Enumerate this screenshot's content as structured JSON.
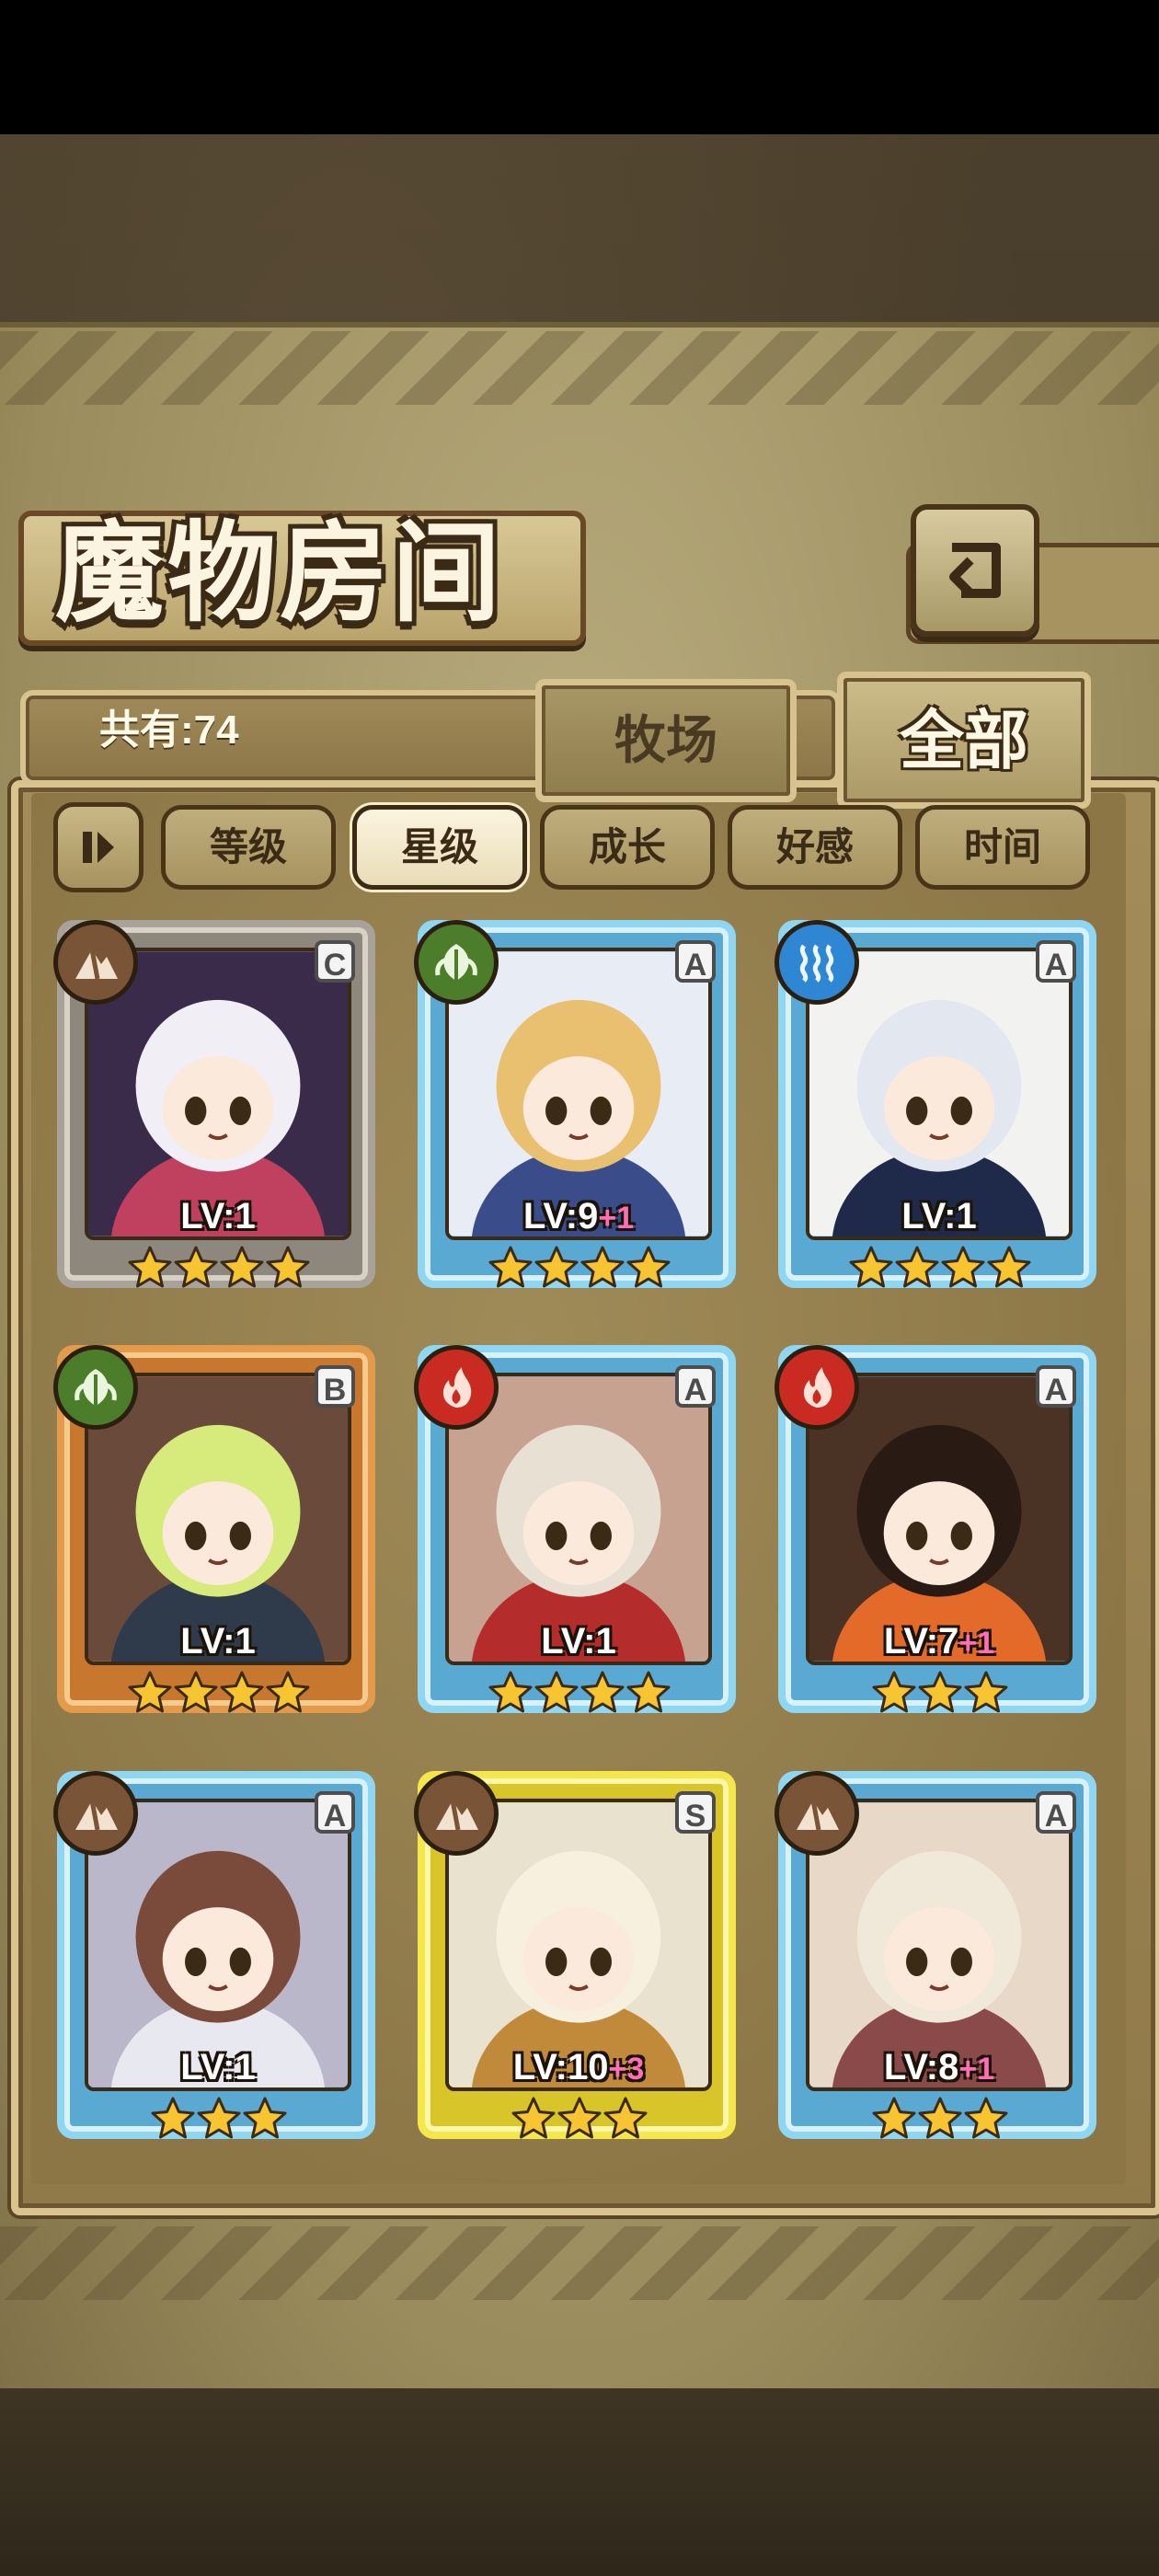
{
  "title": "魔物房间",
  "count_label": "共有:74",
  "tabs": [
    {
      "label": "牧场",
      "active": false
    },
    {
      "label": "全部",
      "active": true
    }
  ],
  "sort_buttons": [
    {
      "label": "等级",
      "active": false
    },
    {
      "label": "星级",
      "active": true
    },
    {
      "label": "成长",
      "active": false
    },
    {
      "label": "好感",
      "active": false
    },
    {
      "label": "时间",
      "active": false
    }
  ],
  "monsters": [
    {
      "rank": "C",
      "element": "earth-icon",
      "level": "LV:1",
      "bonus": "",
      "stars": 4,
      "frame": "c",
      "palette": [
        "#3a2b4a",
        "#f1eef5",
        "#c04060"
      ]
    },
    {
      "rank": "A",
      "element": "leaf-icon",
      "level": "LV:9",
      "bonus": "+1",
      "stars": 4,
      "frame": "a",
      "palette": [
        "#e8ecf4",
        "#e8c070",
        "#3a4d8a"
      ]
    },
    {
      "rank": "A",
      "element": "water-icon",
      "level": "LV:1",
      "bonus": "",
      "stars": 4,
      "frame": "a",
      "palette": [
        "#f2f2f0",
        "#e3e7f0",
        "#1f2a4a"
      ]
    },
    {
      "rank": "B",
      "element": "leaf-icon",
      "level": "LV:1",
      "bonus": "",
      "stars": 4,
      "frame": "b",
      "palette": [
        "#6a4a3a",
        "#d7ea7c",
        "#2f3a4a"
      ]
    },
    {
      "rank": "A",
      "element": "fire-icon",
      "level": "LV:1",
      "bonus": "",
      "stars": 4,
      "frame": "a",
      "palette": [
        "#c7a290",
        "#e8e0d2",
        "#b52c2c"
      ]
    },
    {
      "rank": "A",
      "element": "fire-icon",
      "level": "LV:7",
      "bonus": "+1",
      "stars": 3,
      "frame": "a",
      "palette": [
        "#4a3224",
        "#2a1a14",
        "#e46a2a"
      ]
    },
    {
      "rank": "A",
      "element": "earth-icon",
      "level": "LV:1",
      "bonus": "",
      "stars": 3,
      "frame": "a",
      "palette": [
        "#b9b7c9",
        "#7a4a3a",
        "#e8e8f0"
      ]
    },
    {
      "rank": "S",
      "element": "earth-icon",
      "level": "LV:10",
      "bonus": "+3",
      "stars": 3,
      "frame": "s",
      "palette": [
        "#e9e2cf",
        "#f7f0df",
        "#c08a3a"
      ]
    },
    {
      "rank": "A",
      "element": "earth-icon",
      "level": "LV:8",
      "bonus": "+1",
      "stars": 3,
      "frame": "a",
      "palette": [
        "#e8d8c8",
        "#f0e8d8",
        "#8a4a4a"
      ]
    }
  ],
  "colors": {
    "star": "#f7c531",
    "plus": "#ff6fb5",
    "parchment": "#a99a6a"
  }
}
